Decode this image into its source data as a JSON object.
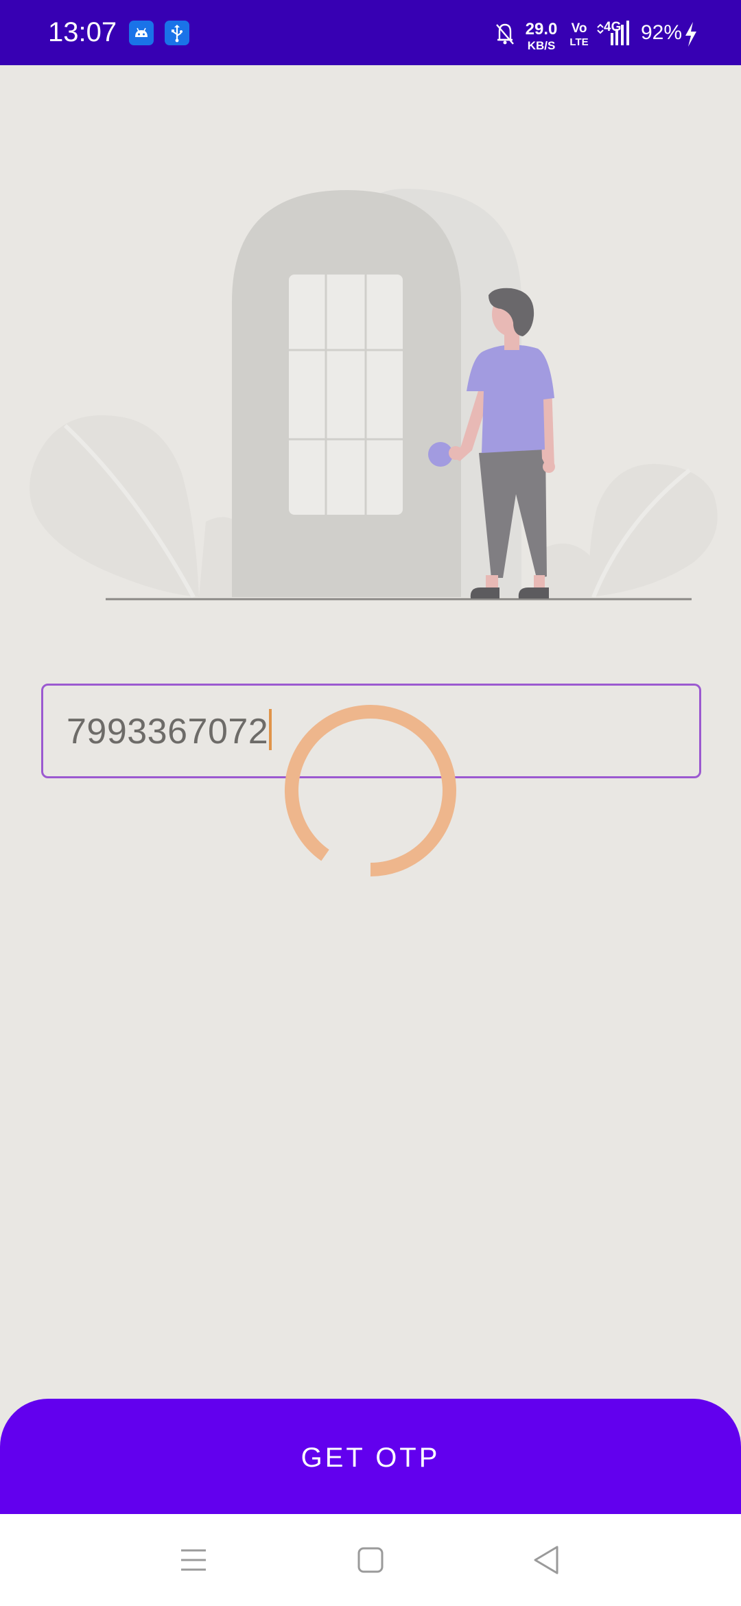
{
  "status_bar": {
    "time": "13:07",
    "left_icons": [
      "android-icon",
      "usb-icon"
    ],
    "network_speed_value": "29.0",
    "network_speed_unit": "KB/S",
    "volte_top": "Vo",
    "volte_bottom": "LTE",
    "network_type": "4G",
    "battery": "92%",
    "right_icons": [
      "bell-muted-icon",
      "signal-icon",
      "charging-icon"
    ]
  },
  "login": {
    "phone_value": "7993367072",
    "loading": true
  },
  "actions": {
    "get_otp_label": "GET OTP"
  },
  "nav_bar": {
    "icons": [
      "menu-icon",
      "home-icon",
      "back-icon"
    ]
  },
  "colors": {
    "status_bar": "#3700b3",
    "primary": "#6200ee",
    "field_border": "#9b59d0",
    "spinner": "#eeb68c",
    "background": "#e9e7e3"
  }
}
